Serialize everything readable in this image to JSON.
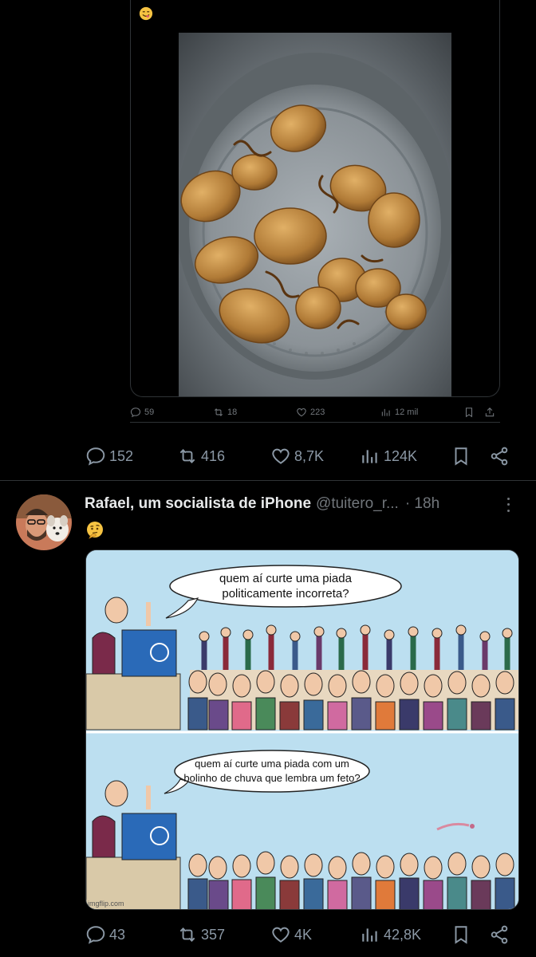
{
  "quoted_tweet": {
    "emoji": "😋",
    "photo_alt": "fried dough fritters in a metal strainer",
    "actions": {
      "replies": "59",
      "reposts": "18",
      "likes": "223",
      "views": "12 mil"
    }
  },
  "main_tweet_actions": {
    "replies": "152",
    "reposts": "416",
    "likes": "8,7K",
    "views": "124K"
  },
  "second_tweet": {
    "author_name": "Rafael, um socialista de iPhone",
    "handle": "@tuitero_r...",
    "time": "· 18h",
    "emoji": "🤔",
    "meme": {
      "panel1_line1": "quem aí curte uma piada",
      "panel1_line2": "politicamente incorreta?",
      "panel2_line1": "quem aí curte uma piada com um",
      "panel2_line2": "bolinho de chuva que lembra um feto?",
      "watermark": "imgflip.com"
    },
    "actions": {
      "replies": "43",
      "reposts": "357",
      "likes": "4K",
      "views": "42,8K"
    }
  },
  "colors": {
    "background": "#000000",
    "text_primary": "#e7e9ea",
    "text_secondary": "#71767b",
    "border": "#2f3336",
    "meme_sky": "#bcdff0"
  }
}
